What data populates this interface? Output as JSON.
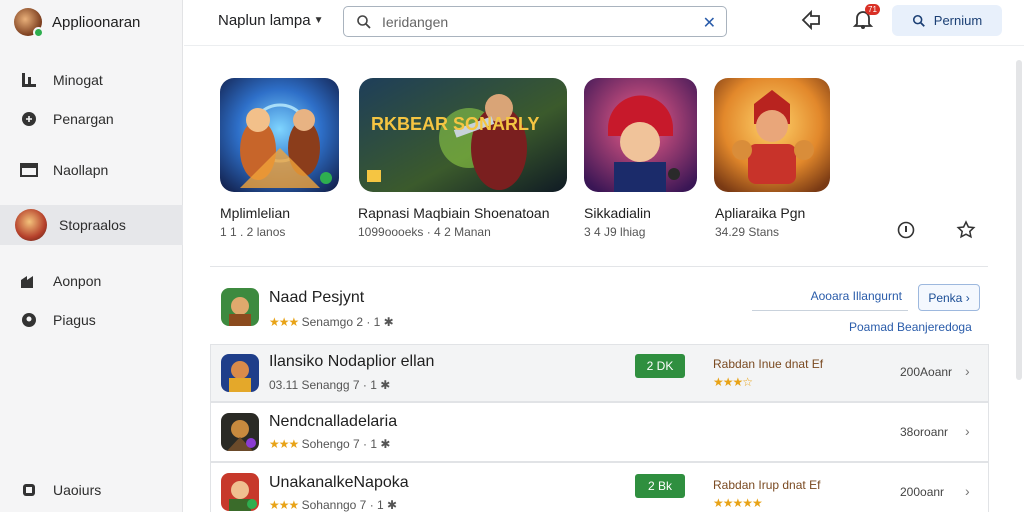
{
  "app": {
    "title": "Applioonaran"
  },
  "sidebar": {
    "items": [
      {
        "label": "Minogat",
        "icon": "chart-icon"
      },
      {
        "label": "Penargan",
        "icon": "shield-icon"
      },
      {
        "label": "Naollapn",
        "icon": "window-icon"
      },
      {
        "label": "Stopraalos",
        "icon": "avatar"
      },
      {
        "label": "Aonpon",
        "icon": "store-icon"
      },
      {
        "label": "Piagus",
        "icon": "pin-icon"
      }
    ],
    "bottom": {
      "label": "Uaoiurs",
      "icon": "user-icon"
    }
  },
  "header": {
    "dropdown_label": "Naplun lampa",
    "search": {
      "value": "Ieridangen",
      "placeholder": "Ieridangen"
    },
    "bell_badge": "71",
    "premium_label": "Pernium"
  },
  "featured": [
    {
      "name": "Mplimlelian",
      "sub": "1 1 . 2 lanos"
    },
    {
      "name": "Rapnasi Maqbiain Shoenatoan",
      "sub": "1099oooeks · 4 2 Manan",
      "art_text": "RKBEAR SONARLY"
    },
    {
      "name": "Sikkadialin",
      "sub": "3 4 J9 lhiag"
    },
    {
      "name": "Apliaraika Pgn",
      "sub": "34.29 Stans"
    }
  ],
  "top_item": {
    "title": "Naad Pesjynt",
    "stars": "★★★",
    "meta": "Senamgo 2 · 1 ✱",
    "link_label": "Aooara Illangurnt",
    "button_label": "Penka",
    "secondary_link": "Poamad Beanjeredoga"
  },
  "rows": [
    {
      "title": "Ilansiko Nodaplior ellan",
      "sub_prefix": "03.11",
      "meta": "Senangg 7 · 1 ✱",
      "stars": "★★★",
      "tag": "2 DK",
      "promo": "Rabdan Inue dnat Ef",
      "promo_stars": "★★★☆",
      "count": "200Aoanr"
    },
    {
      "title": "Nendcnalladelaria",
      "sub_prefix": "",
      "meta": "Sohengo 7 · 1 ✱",
      "stars": "★★★",
      "tag": "",
      "promo": "",
      "promo_stars": "",
      "count": "38oroanr"
    },
    {
      "title": "UnakanalkeNapoka",
      "sub_prefix": "",
      "meta": "Sohanngo 7 · 1 ✱",
      "stars": "★★★",
      "tag": "2 Bk",
      "promo": "Rabdan Irup dnat Ef",
      "promo_stars": "★★★★★",
      "count": "200oanr"
    }
  ],
  "colors": {
    "accent": "#2a5caa",
    "tag_green": "#2f8f3f",
    "star": "#e8a317"
  }
}
